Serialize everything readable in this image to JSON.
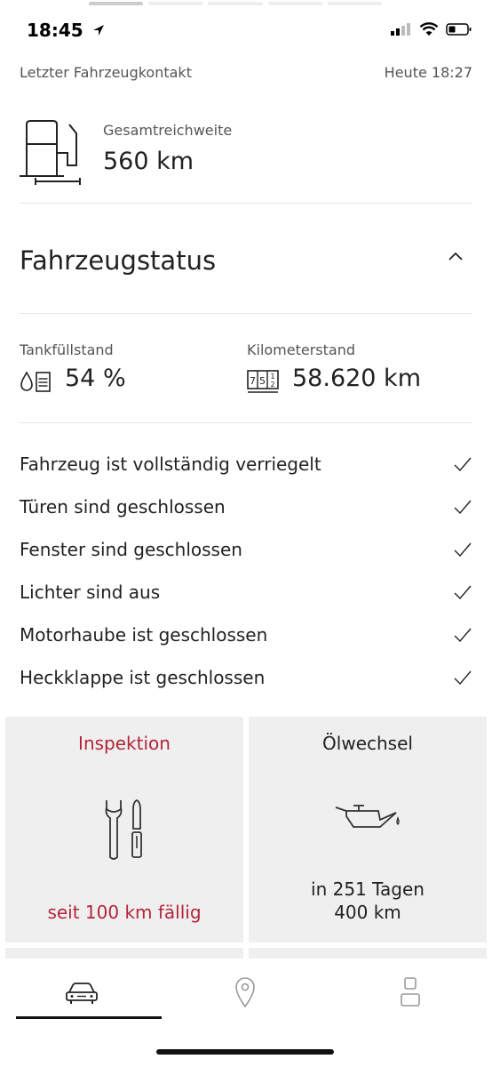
{
  "status_bar": {
    "time": "18:45"
  },
  "last_contact": {
    "label": "Letzter Fahrzeugkontakt",
    "value": "Heute 18:27"
  },
  "range": {
    "label": "Gesamtreichweite",
    "value": "560 km"
  },
  "vehicle_status": {
    "title": "Fahrzeugstatus",
    "fuel": {
      "label": "Tankfüllstand",
      "value": "54 %",
      "percent": 54
    },
    "odometer": {
      "label": "Kilometerstand",
      "value": "58.620 km",
      "icon_text": "75"
    }
  },
  "checks": [
    {
      "label": "Fahrzeug ist vollständig verriegelt"
    },
    {
      "label": "Türen sind geschlossen"
    },
    {
      "label": "Fenster sind geschlossen"
    },
    {
      "label": "Lichter sind aus"
    },
    {
      "label": "Motorhaube ist geschlossen"
    },
    {
      "label": "Heckklappe ist geschlossen"
    }
  ],
  "service": {
    "inspection": {
      "title": "Inspektion",
      "status": "seit 100 km fällig",
      "color": "#b3243a"
    },
    "oil_change": {
      "title": "Ölwechsel",
      "days": "in 251 Tagen",
      "km": "400 km"
    }
  },
  "tabs": [
    {
      "icon": "car-icon",
      "active": true
    },
    {
      "icon": "map-pin-icon",
      "active": false
    },
    {
      "icon": "profile-icon",
      "active": false
    }
  ]
}
